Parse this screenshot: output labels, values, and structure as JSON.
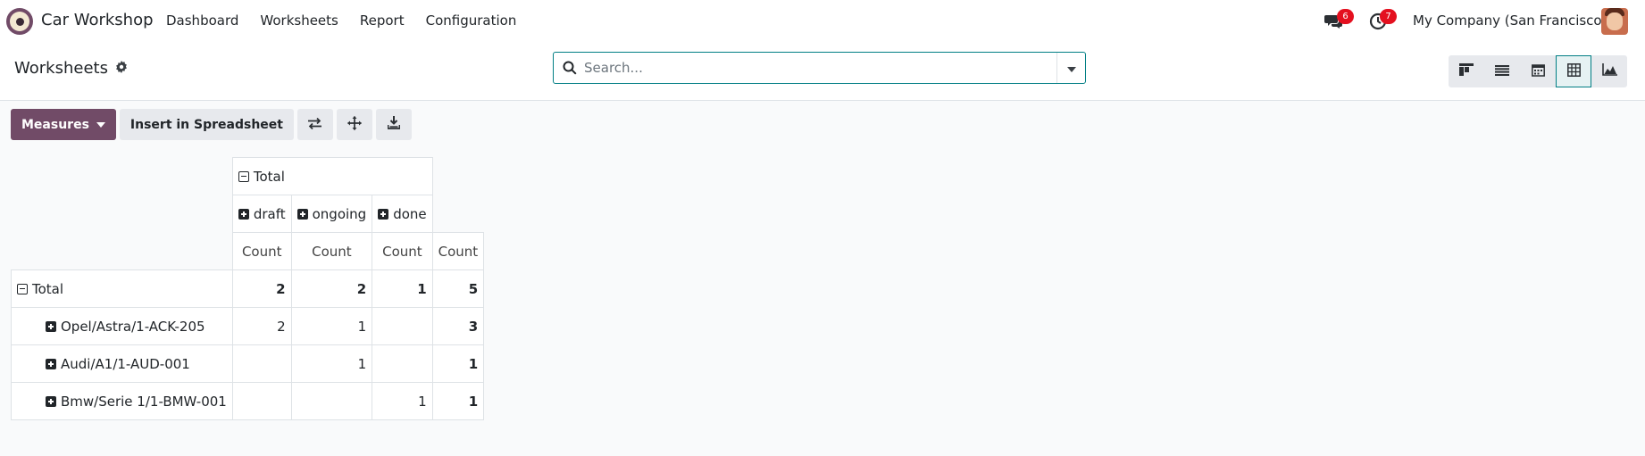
{
  "app": {
    "name": "Car Workshop",
    "logo_icon": "car-workshop-logo-icon",
    "brand_color": "#714B67",
    "accent_color": "#017e84"
  },
  "nav": {
    "items": [
      "Dashboard",
      "Worksheets",
      "Report",
      "Configuration"
    ]
  },
  "systray": {
    "messages_icon": "chat-icon",
    "messages_count": "6",
    "activities_icon": "clock-icon",
    "activities_count": "7",
    "company": "My Company (San Francisco)",
    "avatar_icon": "user-avatar-icon"
  },
  "control_panel": {
    "title": "Worksheets",
    "settings_icon": "gear-icon",
    "search": {
      "placeholder": "Search...",
      "value": "",
      "icon": "search-icon",
      "toggle_icon": "caret-down-icon"
    },
    "views": [
      {
        "name": "kanban",
        "icon": "kanban-icon",
        "active": false
      },
      {
        "name": "list",
        "icon": "list-icon",
        "active": false
      },
      {
        "name": "calendar",
        "icon": "calendar-icon",
        "active": false
      },
      {
        "name": "pivot",
        "icon": "pivot-table-icon",
        "active": true
      },
      {
        "name": "graph",
        "icon": "area-chart-icon",
        "active": false
      }
    ]
  },
  "action_bar": {
    "measures_label": "Measures",
    "insert_label": "Insert in Spreadsheet",
    "flip_icon": "flip-axis-icon",
    "expand_icon": "expand-all-icon",
    "download_icon": "download-icon"
  },
  "pivot": {
    "col_group_label": "Total",
    "col_groups": [
      "draft",
      "ongoing",
      "done"
    ],
    "measure_label": "Count",
    "total_row": {
      "label": "Total",
      "values": [
        "2",
        "2",
        "1",
        "5"
      ]
    },
    "rows": [
      {
        "label": "Opel/Astra/1-ACK-205",
        "values": [
          "2",
          "1",
          "",
          "3"
        ]
      },
      {
        "label": "Audi/A1/1-AUD-001",
        "values": [
          "",
          "1",
          "",
          "1"
        ]
      },
      {
        "label": "Bmw/Serie 1/1-BMW-001",
        "values": [
          "",
          "",
          "1",
          "1"
        ]
      }
    ]
  }
}
